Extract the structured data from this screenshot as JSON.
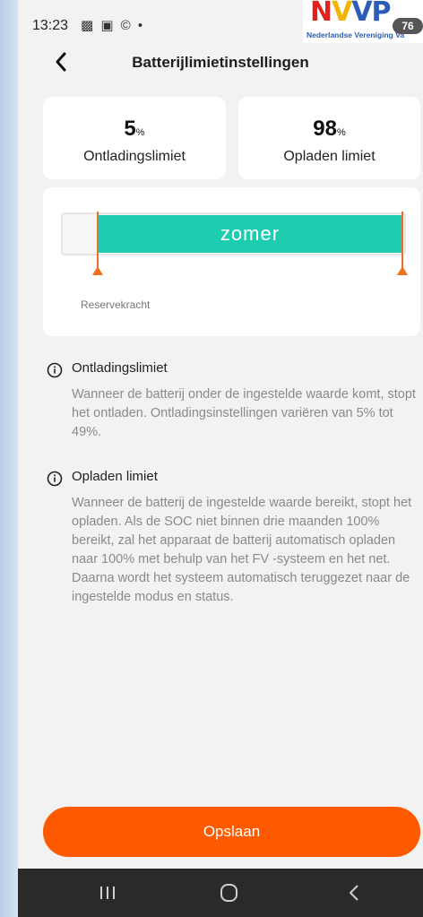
{
  "status_bar": {
    "time": "13:23",
    "icons_text": "▩ ▣ © •",
    "battery": "76"
  },
  "logo": {
    "word_n": "N",
    "word_v1": "V",
    "word_v2": "V",
    "word_p": "P",
    "subtitle": "Nederlandse Vereniging Va"
  },
  "header": {
    "title": "Batterijlimietinstellingen",
    "back_icon": "chevron-left-icon"
  },
  "limits": {
    "discharge": {
      "value": "5",
      "unit": "%",
      "label": "Ontladingslimiet"
    },
    "charge": {
      "value": "98",
      "unit": "%",
      "label": "Opladen limiet"
    }
  },
  "slider": {
    "mode_label": "zomer",
    "reserve_label": "Reservekracht",
    "lower_percent": 5,
    "upper_percent": 98,
    "fill_color": "#1ecdb0",
    "handle_color": "#f0701c"
  },
  "info": [
    {
      "icon": "info-icon",
      "title": "Ontladingslimiet",
      "text": "Wanneer de batterij onder de ingestelde waarde komt, stopt het ontladen. Ontladingsinstellingen variëren van 5% tot 49%."
    },
    {
      "icon": "info-icon",
      "title": "Opladen limiet",
      "text": "Wanneer de batterij de ingestelde waarde bereikt, stopt het opladen. Als de SOC niet binnen drie maanden 100% bereikt, zal het apparaat de batterij automatisch opladen naar 100% met behulp van het FV -systeem en het net. Daarna wordt het systeem automatisch teruggezet naar de ingestelde modus en status."
    }
  ],
  "save_button": {
    "label": "Opslaan",
    "color": "#ff5a00"
  },
  "nav_bar": {
    "recent_icon": "recent-apps-icon",
    "home_icon": "home-icon",
    "back_icon": "back-icon"
  }
}
